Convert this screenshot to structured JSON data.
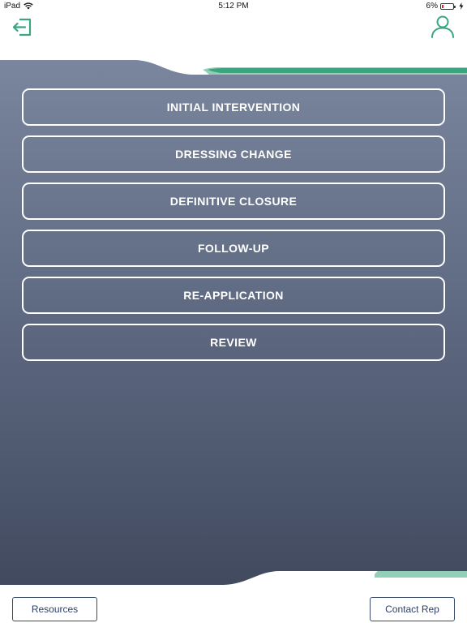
{
  "status_bar": {
    "device": "iPad",
    "time": "5:12 PM",
    "battery": "6%"
  },
  "colors": {
    "accent_green": "#3aa57e",
    "panel_top": "#76829a",
    "panel_bottom": "#414a5f",
    "button_text": "#ffffff"
  },
  "header": {
    "logout_icon": "logout-icon",
    "profile_icon": "user-profile-icon"
  },
  "menu": {
    "items": [
      {
        "label": "INITIAL INTERVENTION"
      },
      {
        "label": "DRESSING CHANGE"
      },
      {
        "label": "DEFINITIVE CLOSURE"
      },
      {
        "label": "FOLLOW-UP"
      },
      {
        "label": "RE-APPLICATION"
      },
      {
        "label": "REVIEW"
      }
    ]
  },
  "footer": {
    "resources_label": "Resources",
    "contact_label": "Contact Rep"
  }
}
